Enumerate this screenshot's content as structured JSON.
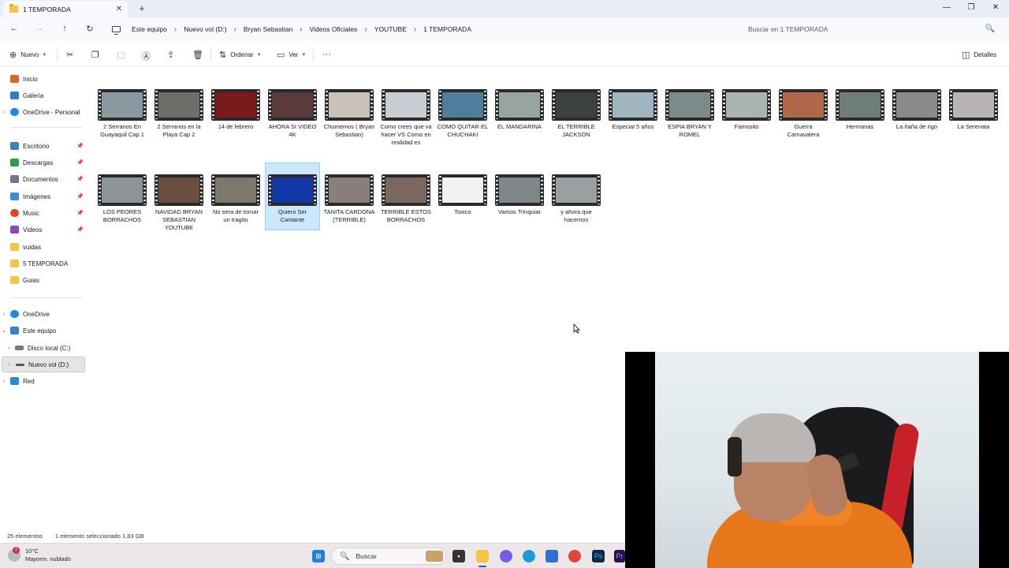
{
  "window": {
    "tab_title": "1 TEMPORADA",
    "tab_close": "✕",
    "new_tab": "+",
    "minimize": "—",
    "maximize": "❐",
    "close": "✕"
  },
  "nav": {
    "back": "←",
    "forward": "→",
    "up": "↑",
    "refresh": "↻"
  },
  "breadcrumb": [
    "Este equipo",
    "Nuevo vol (D:)",
    "Bryan Sebastian",
    "Videos Oficiales",
    "YOUTUBE",
    "1 TEMPORADA"
  ],
  "breadcrumb_sep": "›",
  "search": {
    "placeholder": "Buscar en 1 TEMPORADA",
    "icon": "🔍"
  },
  "commands": {
    "new": "Nuevo",
    "sort": "Ordenar",
    "view": "Ver",
    "more": "···",
    "details": "Detalles"
  },
  "sidebar": {
    "quick": [
      {
        "label": "Inicio",
        "icon": "home-icon",
        "color": "#e0612b"
      },
      {
        "label": "Galería",
        "icon": "gallery-icon",
        "color": "#2f7bd6"
      },
      {
        "label": "OneDrive - Personal",
        "icon": "cloud-icon",
        "color": "#1e88e5"
      }
    ],
    "pinned": [
      {
        "label": "Escritorio",
        "icon": "desktop-icon",
        "color": "#3b82c4"
      },
      {
        "label": "Descargas",
        "icon": "download-icon",
        "color": "#2e9d4f"
      },
      {
        "label": "Documentos",
        "icon": "documents-icon",
        "color": "#6b7a8f"
      },
      {
        "label": "Imágenes",
        "icon": "pictures-icon",
        "color": "#3d8bd9"
      },
      {
        "label": "Music",
        "icon": "music-icon",
        "color": "#e0452b"
      },
      {
        "label": "Videos",
        "icon": "videos-icon",
        "color": "#8a45c9"
      },
      {
        "label": "vuidas",
        "icon": "folder-icon",
        "color": "#f4c542"
      },
      {
        "label": "5 TEMPORADA",
        "icon": "folder-icon",
        "color": "#f4c542"
      },
      {
        "label": "Guias",
        "icon": "folder-icon",
        "color": "#f4c542"
      }
    ],
    "tree": [
      {
        "label": "OneDrive",
        "icon": "cloud-icon",
        "color": "#1e88e5"
      },
      {
        "label": "Este equipo",
        "icon": "pc-icon",
        "color": "#3b82c4"
      },
      {
        "label": "Disco local (C:)",
        "icon": "drive-icon",
        "color": "#6b7a8f"
      },
      {
        "label": "Nuevo vol (D:)",
        "icon": "drive-icon",
        "color": "#555555"
      },
      {
        "label": "Red",
        "icon": "network-icon",
        "color": "#2a8ad4"
      }
    ]
  },
  "files": [
    {
      "name": "2 Serranos En Guayaquil Cap 1",
      "color": "#8a9aa0"
    },
    {
      "name": "2 Serranos en la Playa Cap 2",
      "color": "#6d6f6a"
    },
    {
      "name": "14 de febrero",
      "color": "#7a1a1a"
    },
    {
      "name": "AHORA SI VIDEO 4K",
      "color": "#5a3a3a"
    },
    {
      "name": "Chumemos ( Bryan Sebastian)",
      "color": "#c9c2b8"
    },
    {
      "name": "Como crees que va hacer VS Como en realidad es",
      "color": "#c7cdd2"
    },
    {
      "name": "COMO QUITAR EL CHUCHAKI",
      "color": "#4d7f9a"
    },
    {
      "name": "EL MANDARINA",
      "color": "#98a4a0"
    },
    {
      "name": "EL TERRIBLE JACKSON",
      "color": "#3c4040"
    },
    {
      "name": "Especial 5 años",
      "color": "#9fb6c0"
    },
    {
      "name": "ESPIA BRYAN Y ROMEL",
      "color": "#7c8a8c"
    },
    {
      "name": "Famosito",
      "color": "#a9b3b0"
    },
    {
      "name": "Guerra Carnavalera",
      "color": "#b0674a"
    },
    {
      "name": "Hermanas",
      "color": "#6f7d79"
    },
    {
      "name": "La ñaña de rigo",
      "color": "#8a8a8a"
    },
    {
      "name": "La Serenata",
      "color": "#b9b3b4"
    },
    {
      "name": "LOS PEORES BORRACHOS",
      "color": "#8c9399"
    },
    {
      "name": "NAVIDAD BRYAN SEBASTIAN YOUTUBE",
      "color": "#6a4e3f"
    },
    {
      "name": "No sera de tomar un tragito",
      "color": "#7d776c"
    },
    {
      "name": "Quiero Ser Cantante",
      "color": "#1238a8"
    },
    {
      "name": "TANITA CARDONA (TERRIBLE)",
      "color": "#8a7e7c"
    },
    {
      "name": "TERRIBLE ESTOS BORRACHOS",
      "color": "#7b6660"
    },
    {
      "name": "Toxico",
      "color": "#f2f2f2"
    },
    {
      "name": "Vamos Trinquiar",
      "color": "#7e8789"
    },
    {
      "name": "y ahora que hacemos",
      "color": "#9aa0a2"
    }
  ],
  "selected_file": "Quiero Ser Cantante",
  "status": {
    "count": "25 elementos",
    "selection": "1 elemento seleccionado  1,83 GB"
  },
  "taskbar": {
    "temp": "10°C",
    "weather": "Mayorm. nublado",
    "badge": "2",
    "search_label": "Buscar",
    "apps": [
      {
        "name": "start-icon",
        "color": "#1f7fe0"
      },
      {
        "name": "widgets-icon",
        "color": "#c9a16b"
      },
      {
        "name": "terminal-icon",
        "color": "#333333"
      },
      {
        "name": "file-explorer-icon",
        "color": "#f4c542"
      },
      {
        "name": "copilot-icon",
        "color": "#7a5be8"
      },
      {
        "name": "edge-icon",
        "color": "#1a9bd7"
      },
      {
        "name": "store-icon",
        "color": "#2f6fd6"
      },
      {
        "name": "chrome-icon",
        "color": "#e2453b"
      },
      {
        "name": "photoshop-icon",
        "color": "#0b2a4a"
      },
      {
        "name": "premiere-icon",
        "color": "#2a0f4a"
      }
    ]
  }
}
